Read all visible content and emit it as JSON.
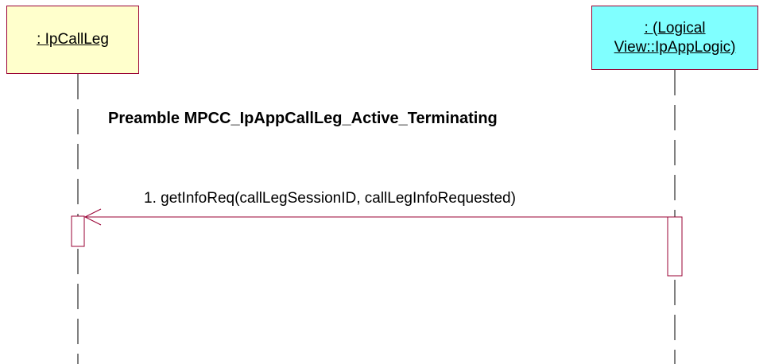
{
  "lifelines": [
    {
      "label": ": IpCallLeg"
    },
    {
      "label": ": (Logical \nView::IpAppLogic)"
    }
  ],
  "title": "Preamble MPCC_IpAppCallLeg_Active_Terminating",
  "message": {
    "label": "1. getInfoReq(callLegSessionID, callLegInfoRequested)"
  },
  "colors": {
    "lifeline_border": "#990033",
    "left_fill": "#ffffcc",
    "right_fill": "#80ffff",
    "message_line": "#990033"
  }
}
